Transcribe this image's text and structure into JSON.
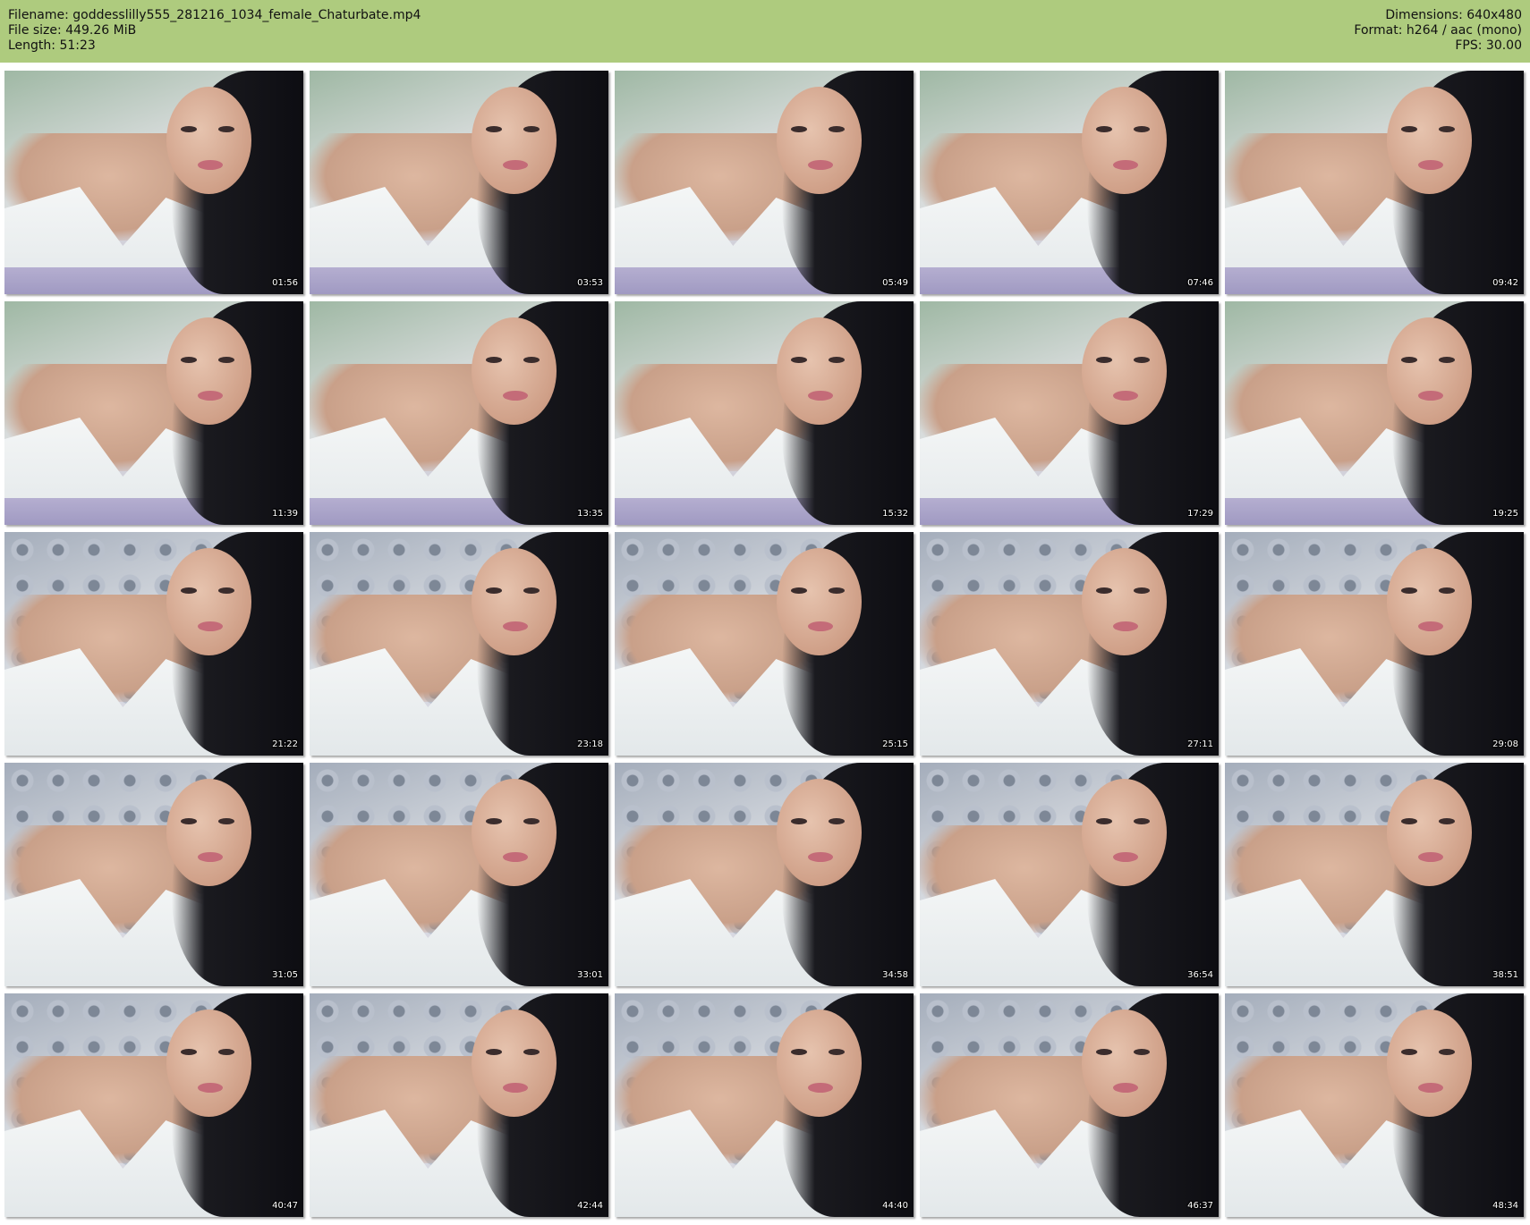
{
  "header": {
    "filename": "Filename: goddesslilly555_281216_1034_female_Chaturbate.mp4",
    "filesize": "File size: 449.26 MiB",
    "length": "Length: 51:23",
    "dimensions": "Dimensions: 640x480",
    "format": "Format: h264 / aac (mono)",
    "fps": "FPS: 30.00"
  },
  "thumbnails": [
    {
      "time": "01:56"
    },
    {
      "time": "03:53"
    },
    {
      "time": "05:49"
    },
    {
      "time": "07:46"
    },
    {
      "time": "09:42"
    },
    {
      "time": "11:39"
    },
    {
      "time": "13:35"
    },
    {
      "time": "15:32"
    },
    {
      "time": "17:29"
    },
    {
      "time": "19:25"
    },
    {
      "time": "21:22"
    },
    {
      "time": "23:18"
    },
    {
      "time": "25:15"
    },
    {
      "time": "27:11"
    },
    {
      "time": "29:08"
    },
    {
      "time": "31:05"
    },
    {
      "time": "33:01"
    },
    {
      "time": "34:58"
    },
    {
      "time": "36:54"
    },
    {
      "time": "38:51"
    },
    {
      "time": "40:47"
    },
    {
      "time": "42:44"
    },
    {
      "time": "44:40"
    },
    {
      "time": "46:37"
    },
    {
      "time": "48:34"
    }
  ],
  "colors": {
    "header_bg": "#aecb7e",
    "timestamp_text": "#ffffff"
  }
}
